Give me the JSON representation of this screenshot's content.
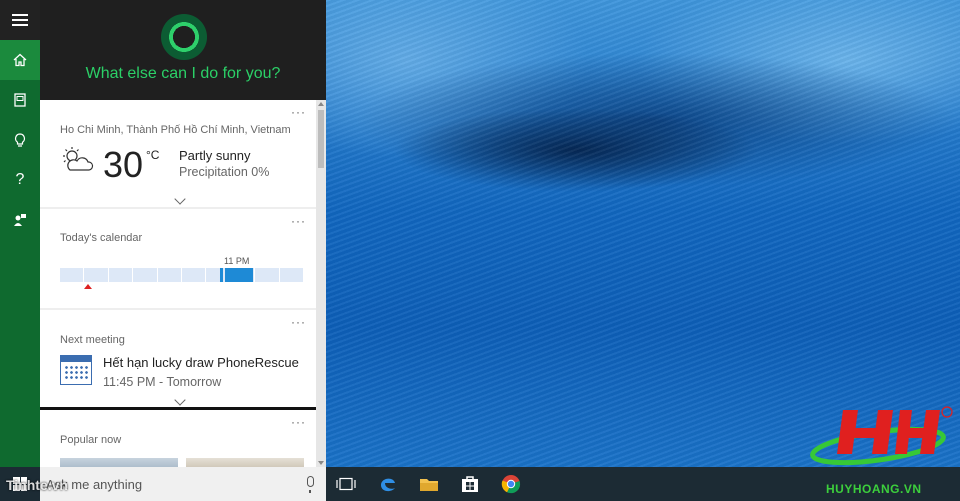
{
  "cortana": {
    "prompt": "What else can I do for you?"
  },
  "rail": {
    "items": [
      "menu",
      "home",
      "notebook",
      "ideas",
      "help",
      "feedback"
    ]
  },
  "weather": {
    "location": "Ho Chi Minh, Thành Phố Hồ Chí Minh, Vietnam",
    "temperature": "30",
    "unit": "°C",
    "condition": "Partly sunny",
    "precipitation": "Precipitation 0%"
  },
  "calendar": {
    "label": "Today's calendar",
    "time_marker": "11 PM"
  },
  "meeting": {
    "label": "Next meeting",
    "title": "Hết hạn lucky draw PhoneRescue",
    "time": "11:45 PM - Tomorrow"
  },
  "popular": {
    "label": "Popular now"
  },
  "card_menu": "···",
  "search": {
    "placeholder": "Ask me anything"
  },
  "taskbar": {
    "apps": [
      "task-view",
      "edge",
      "file-explorer",
      "store",
      "chrome"
    ]
  },
  "watermarks": {
    "left": "Tinhte.vn",
    "right": "HUYHOANG.VN"
  },
  "colors": {
    "accent_green": "#2bd067",
    "rail_green": "#0f6a2f",
    "calendar_event": "#1e8ad6"
  }
}
